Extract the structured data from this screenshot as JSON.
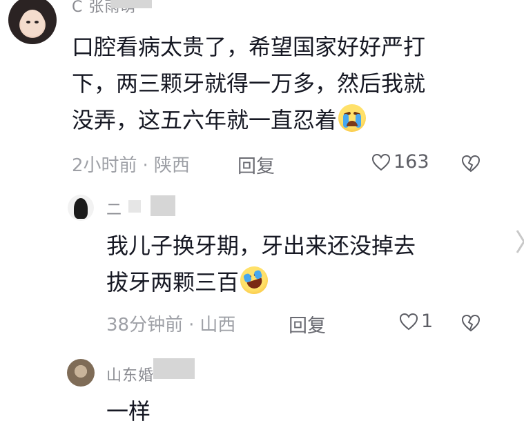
{
  "comments": [
    {
      "username": "C 张雨萌",
      "lines": [
        "口腔看病太贵了，希望国家好好严打",
        "下，两三颗牙就得一万多，然后我就",
        "没弄，这五六年就一直忍着"
      ],
      "emoji": "crying-face",
      "time": "2小时前",
      "location": "陕西",
      "reply_label": "回复",
      "likes": "163"
    },
    {
      "username": "二",
      "lines": [
        "我儿子换牙期，牙出来还没掉去",
        "拔牙两颗三百"
      ],
      "emoji": "rolling-laughing-face",
      "time": "38分钟前",
      "location": "山西",
      "reply_label": "回复",
      "likes": "1"
    },
    {
      "username": "山东婚",
      "lines": [
        "一样"
      ]
    }
  ],
  "colors": {
    "text": "#161823",
    "meta": "#9ea0a6",
    "username": "#8a8b91"
  },
  "icons": [
    "heart-icon",
    "broken-heart-icon",
    "chevron-right-icon"
  ]
}
